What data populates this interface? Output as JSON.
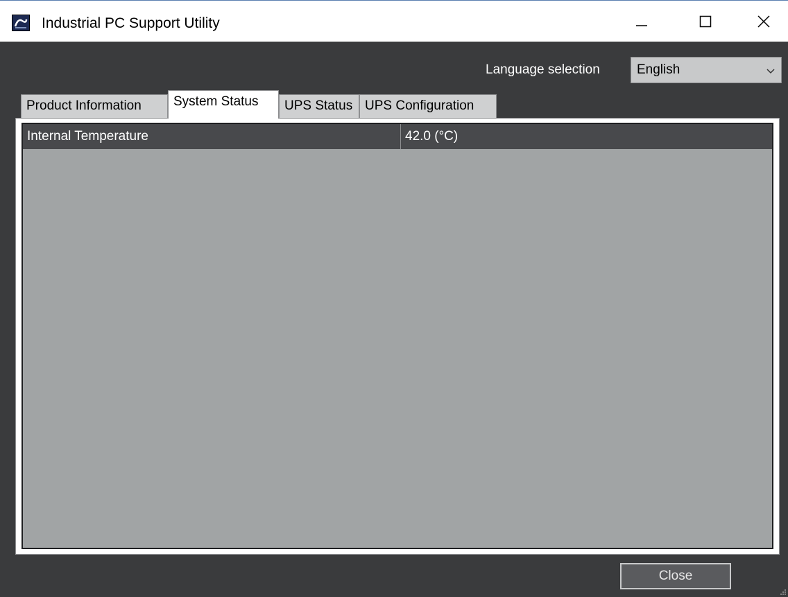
{
  "window": {
    "title": "Industrial PC Support Utility",
    "icon": "app-logo-icon",
    "controls": [
      "minimize-icon",
      "maximize-icon",
      "close-icon"
    ]
  },
  "language": {
    "label": "Language selection",
    "selected": "English",
    "icon": "chevron-down-icon"
  },
  "tabs": [
    {
      "label": "Product Information",
      "active": false
    },
    {
      "label": "System Status",
      "active": true
    },
    {
      "label": "UPS Status",
      "active": false
    },
    {
      "label": "UPS Configuration",
      "active": false
    }
  ],
  "status_table": {
    "rows": [
      {
        "name": "Internal Temperature",
        "value": "42.0 (°C)"
      }
    ]
  },
  "footer": {
    "close_label": "Close"
  },
  "colors": {
    "window_bg": "#3a3b3d",
    "panel_bg": "#a1a4a5",
    "row_bg": "#48494c"
  }
}
